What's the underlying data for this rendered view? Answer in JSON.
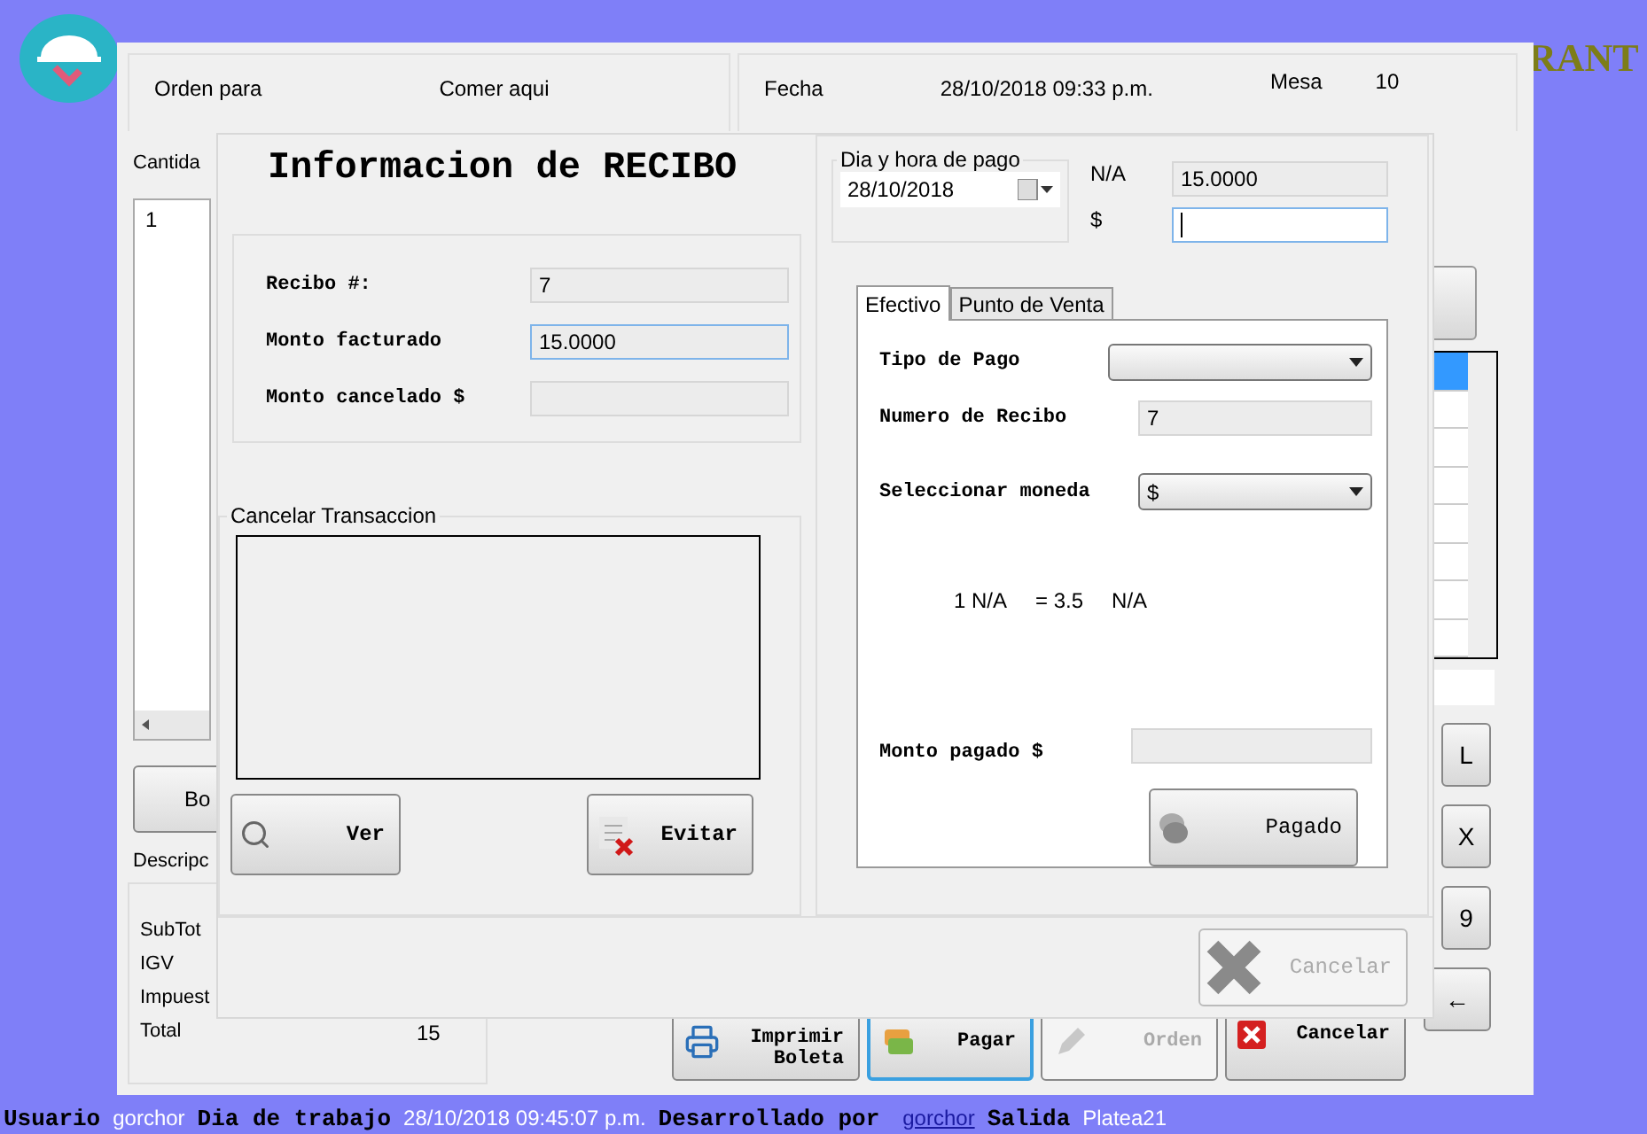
{
  "brand_text": "RANT",
  "order_header": {
    "orden_para_label": "Orden para",
    "orden_para_value": "Comer aqui",
    "fecha_label": "Fecha",
    "fecha_value": "28/10/2018 09:33 p.m.",
    "mesa_label": "Mesa",
    "mesa_value": "10"
  },
  "order_items": {
    "column_1": "Cantida",
    "rows": [
      "1"
    ]
  },
  "left_button": "Bo",
  "summary": {
    "title": "Descripc",
    "rows": [
      {
        "label": "SubTot"
      },
      {
        "label": "IGV"
      },
      {
        "label": "Impuest"
      },
      {
        "label": "Total",
        "value": "15"
      }
    ]
  },
  "grid_rows": [
    {
      "selected": true
    },
    {
      "selected": false
    },
    {
      "selected": false
    },
    {
      "selected": false
    },
    {
      "selected": false
    },
    {
      "selected": false
    },
    {
      "selected": false
    },
    {
      "selected": false
    }
  ],
  "keypad": [
    "L",
    "X",
    "9",
    "←"
  ],
  "actions": [
    {
      "label": "Imprimir Boleta",
      "kind": "print",
      "focused": false,
      "disabled": false
    },
    {
      "label": "Pagar",
      "kind": "pay",
      "focused": true,
      "disabled": false
    },
    {
      "label": "Orden",
      "kind": "order",
      "focused": false,
      "disabled": true
    },
    {
      "label": "Cancelar",
      "kind": "cancel",
      "focused": false,
      "disabled": false
    }
  ],
  "dialog": {
    "title": "Informacion de RECIBO",
    "recibo_fields": [
      {
        "label": "Recibo #:",
        "value": "7",
        "focused": false
      },
      {
        "label": "Monto facturado",
        "value": "15.0000",
        "focused": true
      },
      {
        "label": "Monto cancelado $",
        "focused": false
      }
    ],
    "cancel_group": {
      "title": "Cancelar Transaccion",
      "buttons": [
        {
          "label": "Ver",
          "kind": "view"
        },
        {
          "label": "Evitar",
          "kind": "void"
        }
      ]
    },
    "payment_date": {
      "title": "Dia y hora de pago",
      "value": "28/10/2018"
    },
    "currency_rows": [
      {
        "label": "N/A",
        "value": "15.0000",
        "focused": false
      },
      {
        "label": "$",
        "focused": true
      }
    ],
    "tabs": [
      {
        "label": "Efectivo",
        "selected": true
      },
      {
        "label": "Punto de Venta",
        "selected": false
      }
    ],
    "form": [
      {
        "kind": "select",
        "label": "Tipo de Pago"
      },
      {
        "kind": "field",
        "label": "Numero de Recibo",
        "value": "7"
      },
      {
        "kind": "select",
        "label": "Seleccionar moneda",
        "value": "$"
      },
      {
        "kind": "rate",
        "parts": [
          "1 N/A",
          "= 3.5",
          "N/A"
        ]
      },
      {
        "kind": "field",
        "label": "Monto pagado  $"
      }
    ],
    "paid_button": "Pagado",
    "cancel_button": {
      "label": "Cancelar",
      "disabled": true
    }
  },
  "status_bar": [
    {
      "kind": "label",
      "text": "Usuario"
    },
    {
      "kind": "value",
      "text": "gorchor"
    },
    {
      "kind": "label",
      "text": "Dia de trabajo"
    },
    {
      "kind": "value",
      "text": "28/10/2018 09:45:07 p.m."
    },
    {
      "kind": "label",
      "text": "Desarrollado por"
    },
    {
      "kind": "link",
      "text": "gorchor"
    },
    {
      "kind": "label",
      "text": "Salida"
    },
    {
      "kind": "value",
      "text": "Platea21"
    }
  ]
}
